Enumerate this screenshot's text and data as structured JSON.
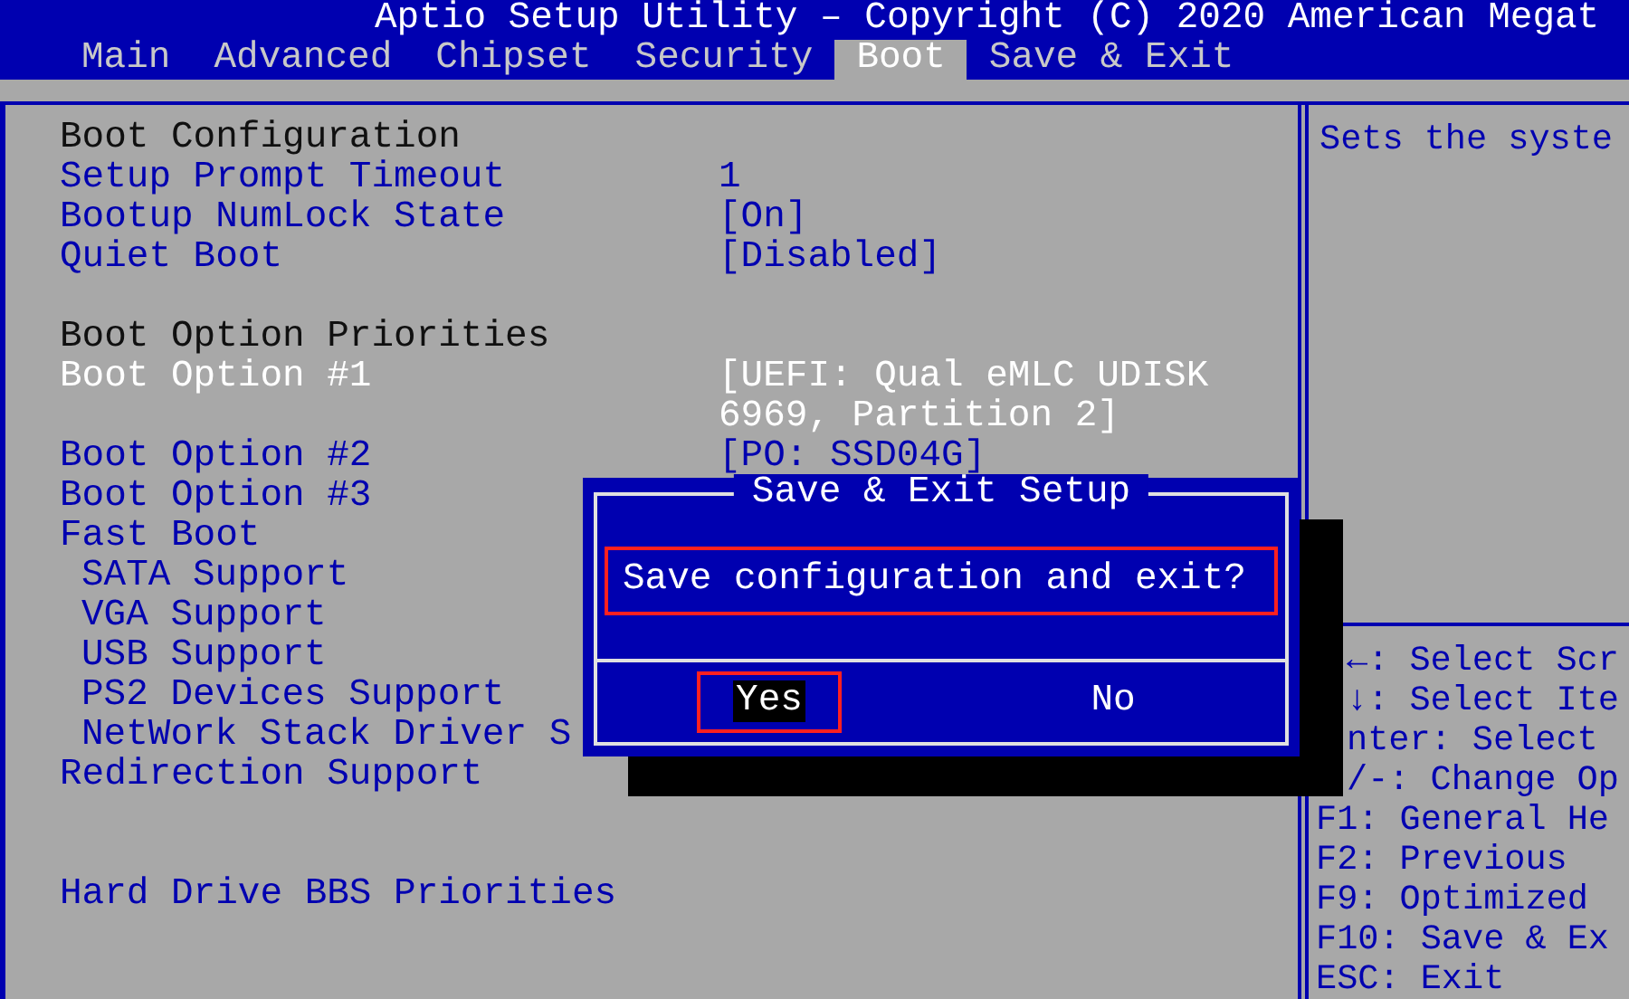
{
  "title": "Aptio Setup Utility – Copyright (C) 2020 American Megat",
  "tabs": [
    {
      "label": "Main",
      "selected": false
    },
    {
      "label": "Advanced",
      "selected": false
    },
    {
      "label": "Chipset",
      "selected": false
    },
    {
      "label": "Security",
      "selected": false
    },
    {
      "label": "Boot",
      "selected": true
    },
    {
      "label": "Save & Exit",
      "selected": false
    }
  ],
  "sections": [
    {
      "items": [
        {
          "label": "Boot Configuration",
          "kind": "heading",
          "selected": false
        },
        {
          "label": "Setup Prompt Timeout",
          "kind": "setting",
          "selected": false,
          "value": "1"
        },
        {
          "label": "Bootup NumLock State",
          "kind": "setting",
          "selected": false,
          "value": "[On]"
        },
        {
          "label": "Quiet Boot",
          "kind": "setting",
          "selected": false,
          "value": "[Disabled]"
        }
      ]
    },
    {
      "items": [
        {
          "label": "Boot Option Priorities",
          "kind": "heading",
          "selected": false
        },
        {
          "label": "Boot Option #1",
          "kind": "setting",
          "selected": true,
          "value": "[UEFI: Qual eMLC UDISK 6969, Partition 2]"
        },
        {
          "label": "Boot Option #2",
          "kind": "setting",
          "selected": false,
          "value": "[PO: SSD04G]"
        },
        {
          "label": "Boot Option #3",
          "kind": "setting",
          "selected": false
        },
        {
          "label": "Fast Boot",
          "kind": "setting",
          "selected": false
        },
        {
          "label": "SATA Support",
          "kind": "sub",
          "selected": false
        },
        {
          "label": "VGA Support",
          "kind": "sub",
          "selected": false
        },
        {
          "label": "USB Support",
          "kind": "sub",
          "selected": false
        },
        {
          "label": "PS2 Devices Support",
          "kind": "sub",
          "selected": false
        },
        {
          "label": "NetWork Stack Driver S",
          "kind": "sub",
          "selected": false
        },
        {
          "label": "Redirection Support",
          "kind": "setting",
          "selected": false
        }
      ]
    },
    {
      "items": [
        {
          "label": "Hard Drive BBS Priorities",
          "kind": "setting",
          "selected": false
        }
      ]
    }
  ],
  "help": {
    "description": "Sets the syste",
    "keys": [
      {
        "text": "←: Select Scr",
        "obscured": true
      },
      {
        "text": "↓: Select Ite",
        "obscured": true
      },
      {
        "text": "nter: Select",
        "obscured": true
      },
      {
        "text": "/-: Change Op",
        "obscured": true
      },
      {
        "text": "F1: General He",
        "obscured": false
      },
      {
        "text": "F2: Previous",
        "obscured": false
      },
      {
        "text": "F9: Optimized",
        "obscured": false
      },
      {
        "text": "F10: Save & Ex",
        "obscured": false
      },
      {
        "text": "ESC: Exit",
        "obscured": false
      }
    ]
  },
  "dialog": {
    "title": "Save & Exit Setup",
    "prompt": "Save configuration and exit?",
    "prompt_highlighted": true,
    "buttons": [
      {
        "label": "Yes",
        "selected": true,
        "highlighted": true
      },
      {
        "label": "No",
        "selected": false,
        "highlighted": false
      }
    ]
  }
}
